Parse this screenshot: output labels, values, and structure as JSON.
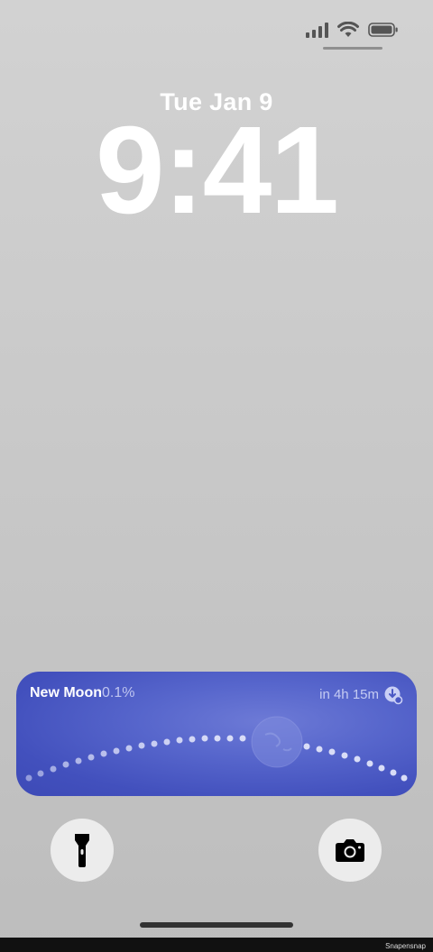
{
  "status_bar": {
    "signal_icon": "cellular-signal-icon",
    "wifi_icon": "wifi-icon",
    "battery_icon": "battery-icon"
  },
  "lockscreen": {
    "date": "Tue Jan 9",
    "time": "9:41"
  },
  "moon_widget": {
    "phase_name": "New Moon",
    "illumination": "0.1%",
    "next_event": "in 4h 15m",
    "event_icon": "moonrise-icon",
    "accent_color": "#4a58c4"
  },
  "quick_actions": {
    "left": {
      "icon": "flashlight-icon"
    },
    "right": {
      "icon": "camera-icon"
    }
  },
  "watermark": "Snapensnap"
}
